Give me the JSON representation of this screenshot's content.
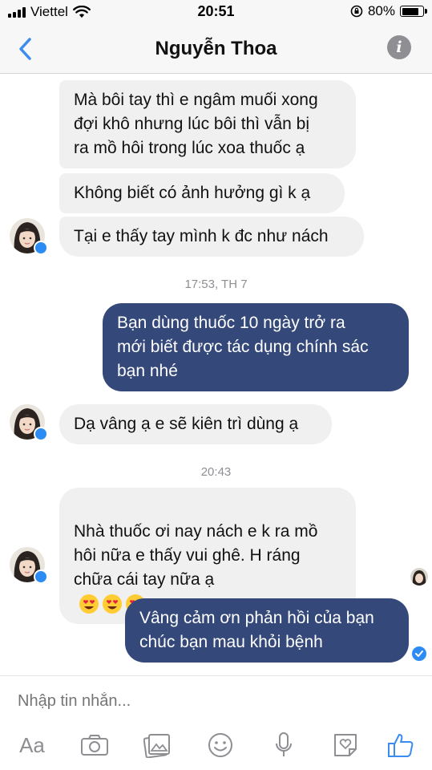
{
  "status_bar": {
    "carrier": "Viettel",
    "time": "20:51",
    "battery_text": "80%",
    "battery_level": 0.8
  },
  "header": {
    "title": "Nguyễn Thoa",
    "back_icon": "chevron-left-icon",
    "info_icon": "info-icon"
  },
  "thread": {
    "messages": [
      {
        "from": "contact",
        "text": "Mà bôi tay thì e ngâm muối xong\nđợi khô nhưng lúc bôi thì vẫn bị\nra mồ hôi trong lúc xoa thuốc ạ"
      },
      {
        "from": "contact",
        "text": "Không biết có ảnh hưởng gì k ạ"
      },
      {
        "from": "contact",
        "text": "Tại e thấy tay mình k đc như nách"
      },
      {
        "from": "me",
        "text": "Bạn dùng thuốc 10 ngày trở ra\nmới biết được tác dụng chính sác\nbạn nhé"
      },
      {
        "from": "contact",
        "text": "Dạ vâng ạ e sẽ kiên trì dùng ạ"
      },
      {
        "from": "contact",
        "text": "Nhà thuốc ơi nay nách e k ra mồ\nhôi nữa e thấy vui ghê. H ráng\nchữa cái tay nữa ạ"
      },
      {
        "from": "me",
        "text": "Vâng cảm ơn phản hồi của bạn\nchúc bạn mau khỏi bệnh"
      }
    ],
    "timestamps": [
      "17:53, TH 7",
      "20:43"
    ]
  },
  "composer": {
    "placeholder": "Nhập tin nhắn...",
    "aa_label": "Aa",
    "icons": [
      "camera-icon",
      "gallery-icon",
      "emoji-icon",
      "microphone-icon",
      "sticker-icon",
      "like-icon"
    ]
  },
  "colors": {
    "outgoing_bubble": "#34487a",
    "incoming_bubble": "#f1f0f0",
    "accent": "#2c8cf4"
  }
}
